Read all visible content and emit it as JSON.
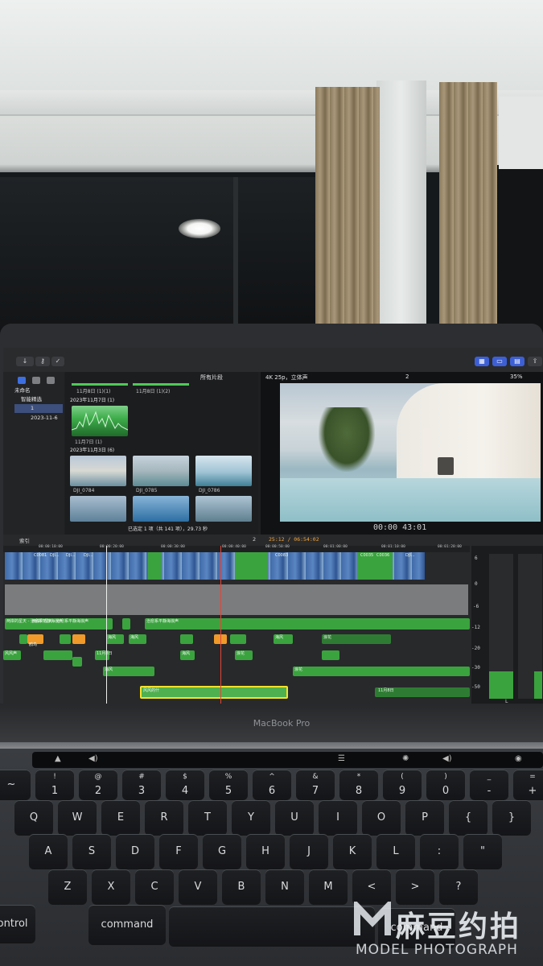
{
  "viewer": {
    "format": "4K 25p，立体声",
    "zoom": "35%",
    "timecode": "00:00 43:01",
    "clip_count_badge": "2"
  },
  "browser": {
    "filter": "所有片段",
    "top_caption_left": "11月8日 (1)(1)",
    "top_caption_right": "11月8日 (1)(2)",
    "group1_header": "2023年11月7日 (1)",
    "group1_clip": "11月7日 (1)",
    "group2_header": "2023年11月3日 (6)",
    "clips": [
      "DJI_0784",
      "DJI_0785",
      "DJI_0786"
    ],
    "selection_status": "已选定 1 项（共 141 项），29.73 秒"
  },
  "sidebar": {
    "library": "未命名",
    "items": [
      "智能精选",
      "1",
      "2023-11-6"
    ]
  },
  "timeline": {
    "index_label": "索引",
    "counter": "2",
    "playhead_timecode": "25:12 / 06:54:02",
    "ruler": [
      "00:00:10:00",
      "00:00:20:00",
      "00:00:30:00",
      "00:00:40:00",
      "00:00:50:00",
      "00:01:00:00",
      "00:01:10:00",
      "00:01:20:00"
    ],
    "video_clips": [
      "C0081",
      "DJI...",
      "DJI...",
      "DJI...",
      "C0083",
      "C0035",
      "C0036",
      "DJI..."
    ],
    "audio_clips": [
      "两岸的星天 - 治愈系平静海浪声",
      "两岸的星天 - 治愈系平静海浪声",
      "治愈系平静海浪声"
    ],
    "sfx_labels": [
      "鸥鸟",
      "海风",
      "海风",
      "海风",
      "浪花",
      "11月8日",
      "风风声",
      "海风",
      "浪花",
      "海风",
      "浪花"
    ],
    "selected_clip": "风风的什",
    "bottom_clip": "11月8日",
    "meter_labels": [
      "6",
      "0",
      "-6",
      "-12",
      "-20",
      "-30",
      "-50",
      "L"
    ]
  },
  "laptop": {
    "model": "MacBook Pro"
  },
  "keyboard": {
    "row1": [
      "~",
      "1",
      "2",
      "3",
      "4",
      "5",
      "6",
      "7",
      "8",
      "9",
      "0",
      "-",
      "+"
    ],
    "row1_top": [
      "!",
      "@",
      "#",
      "$",
      "%",
      "^",
      "&",
      "*",
      "(",
      ")",
      "_",
      "="
    ],
    "row2": [
      "Q",
      "W",
      "E",
      "R",
      "T",
      "Y",
      "U",
      "I",
      "O",
      "P",
      "{",
      "}"
    ],
    "row3": [
      "A",
      "S",
      "D",
      "F",
      "G",
      "H",
      "J",
      "K",
      "L",
      ":",
      "\""
    ],
    "row4": [
      "Z",
      "X",
      "C",
      "V",
      "B",
      "N",
      "M",
      "<",
      ">",
      "?"
    ],
    "row5": [
      "control",
      "command",
      "command"
    ]
  },
  "watermark": {
    "brand": "麻豆约拍",
    "sub": "MODEL PHOTOGRAPH"
  }
}
